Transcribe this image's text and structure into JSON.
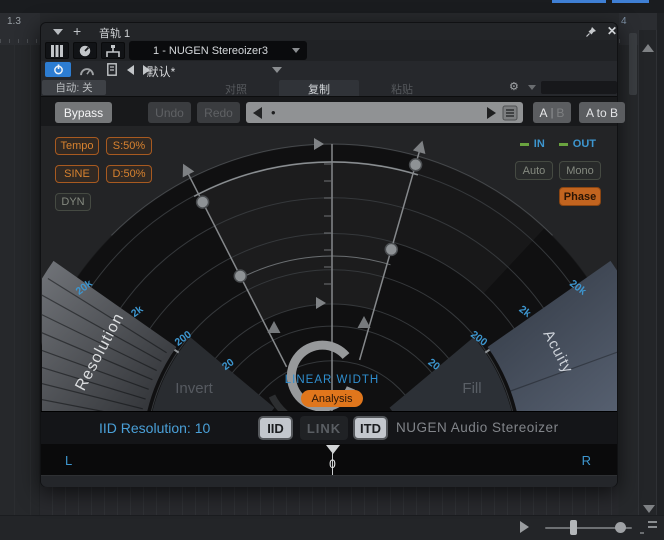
{
  "colors": {
    "accent_blue": "#2d7dd2",
    "label_blue": "#3d96cf",
    "orange": "#d4711f",
    "meter_green": "#6aa33f"
  },
  "host": {
    "ruler_left": "1.3",
    "ruler_right": "4"
  },
  "titlebar": {
    "title": "音轨 1"
  },
  "rack": {
    "plugin_selector": "1 - NUGEN Stereoizer3",
    "preset": "默认*",
    "automation": "自动: 关",
    "compare": "对照",
    "copy": "复制",
    "paste": "粘贴"
  },
  "toolbar": {
    "bypass": "Bypass",
    "undo": "Undo",
    "redo": "Redo",
    "nav_marker": "•",
    "ab_a": "A",
    "ab_sep": "|",
    "ab_b": "B",
    "a_to_b": "A to B"
  },
  "display": {
    "tempo": "Tempo",
    "s_value": "S:50%",
    "sine": "SINE",
    "d_value": "D:50%",
    "dyn": "DYN",
    "in_label": "IN",
    "out_label": "OUT",
    "auto": "Auto",
    "mono": "Mono",
    "phase": "Phase",
    "resolution": "Resolution",
    "invert": "Invert",
    "fill": "Fill",
    "acuity": "Acuity",
    "linear_width": "LINEAR WIDTH",
    "analysis": "Analysis",
    "freq_left": [
      "20k",
      "2k",
      "200",
      "20"
    ],
    "freq_right": [
      "20",
      "200",
      "2k",
      "20k"
    ]
  },
  "footer": {
    "status": "IID Resolution: 10",
    "iid": "IID",
    "link": "LINK",
    "itd": "ITD",
    "brand": "NUGEN Audio Stereoizer"
  },
  "pan": {
    "left": "L",
    "right": "R",
    "value": "0"
  }
}
